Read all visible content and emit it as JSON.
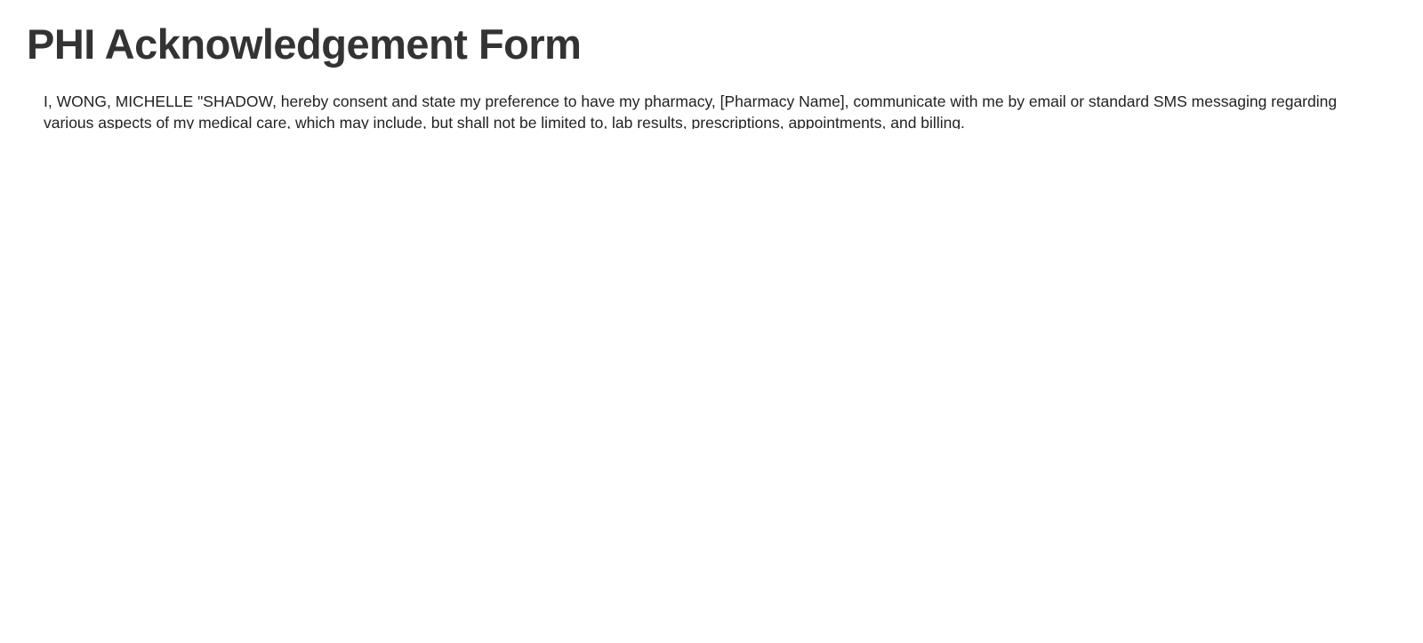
{
  "page": {
    "title": "PHI Acknowledgement Form",
    "consent_text": "I, WONG, MICHELLE \"SHADOW, hereby consent and state my preference to have my pharmacy, [Pharmacy Name], communicate with me by email or standard SMS messaging regarding various aspects of my medical care, which may include, but shall not be limited to, lab results, prescriptions, appointments, and billing."
  }
}
